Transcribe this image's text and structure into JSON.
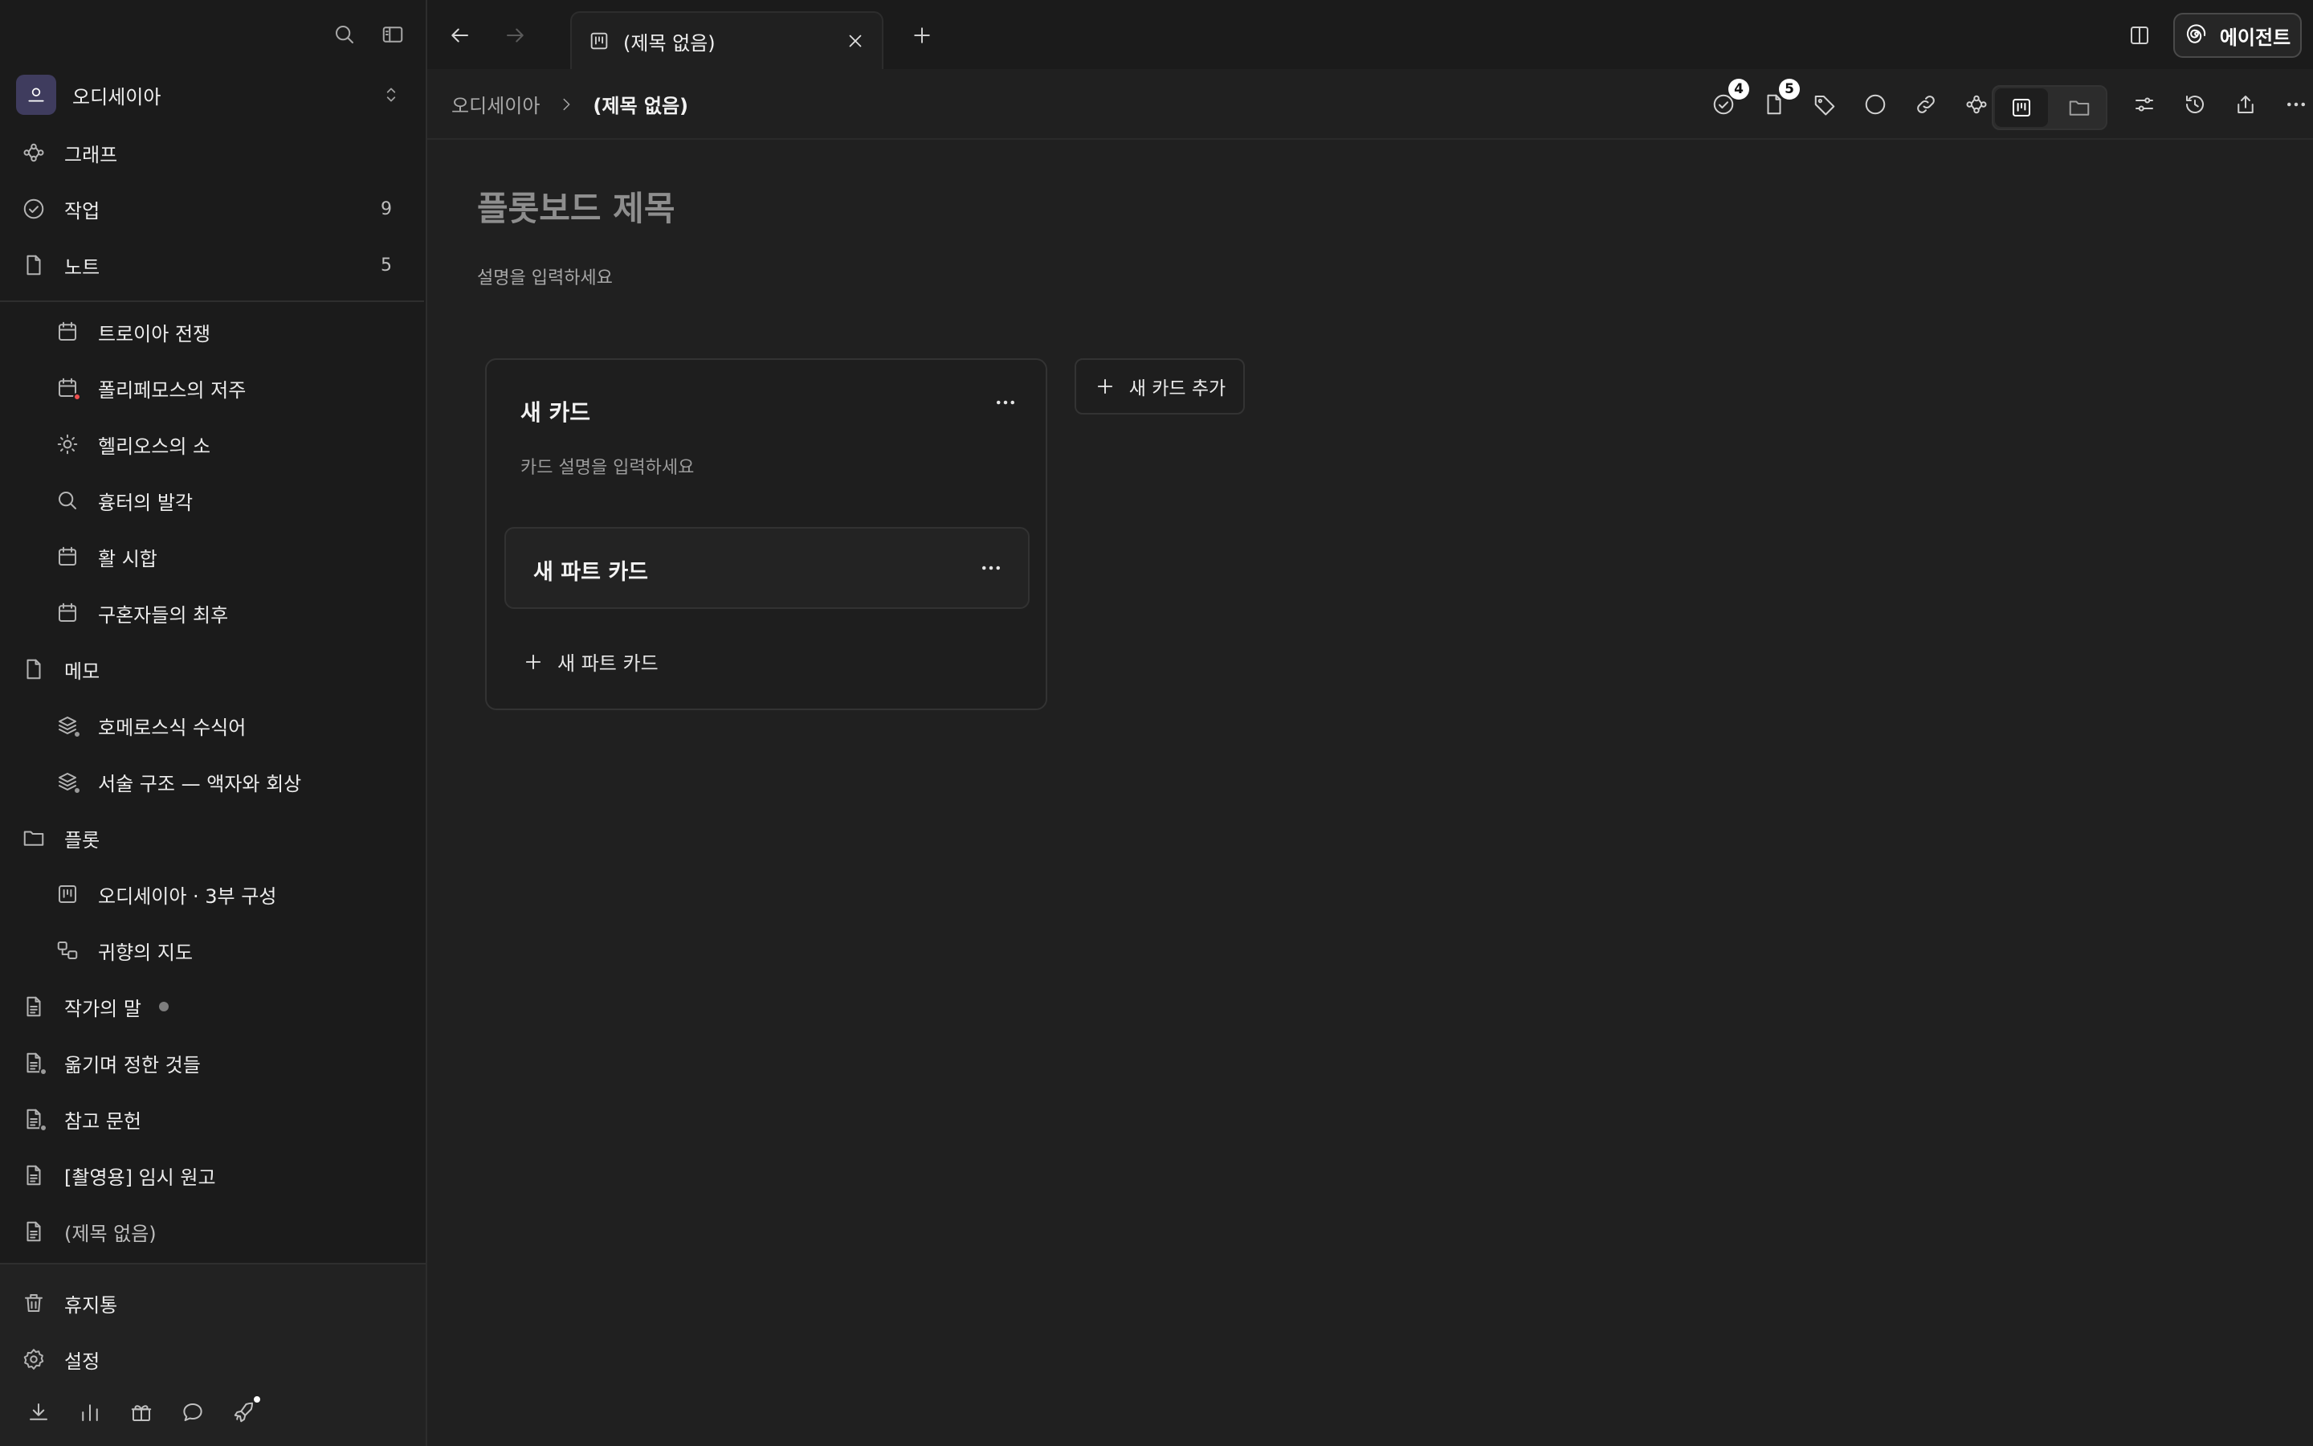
{
  "sidebar": {
    "workspace": {
      "initial": "오",
      "name": "오디세이아"
    },
    "nav": [
      {
        "label": "그래프"
      },
      {
        "label": "작업",
        "count": "9"
      },
      {
        "label": "노트",
        "count": "5"
      }
    ],
    "tree": [
      {
        "label": "트로이아 전쟁"
      },
      {
        "label": "폴리페모스의 저주"
      },
      {
        "label": "헬리오스의 소"
      },
      {
        "label": "흉터의 발각"
      },
      {
        "label": "활 시합"
      },
      {
        "label": "구혼자들의 최후"
      },
      {
        "label": "메모"
      },
      {
        "label": "호메로스식 수식어"
      },
      {
        "label": "서술 구조 — 액자와 회상"
      },
      {
        "label": "플롯"
      },
      {
        "label": "오디세이아 · 3부 구성"
      },
      {
        "label": "귀향의 지도"
      },
      {
        "label": "작가의 말"
      },
      {
        "label": "옮기며 정한 것들"
      },
      {
        "label": "참고 문헌"
      },
      {
        "label": "[촬영용] 임시 원고"
      },
      {
        "label": "(제목 없음)"
      }
    ],
    "bottom": {
      "trash": "휴지통",
      "settings": "설정"
    }
  },
  "tabs": [
    {
      "label": "(제목 없음)"
    }
  ],
  "agent_label": "에이전트",
  "breadcrumb": {
    "root": "오디세이아",
    "current": "(제목 없음)"
  },
  "toolbar_badges": {
    "tasks": "4",
    "notes": "5"
  },
  "board": {
    "title_placeholder": "플롯보드 제목",
    "desc_placeholder": "설명을 입력하세요",
    "card": {
      "title": "새 카드",
      "desc_placeholder": "카드 설명을 입력하세요",
      "part": {
        "title": "새 파트 카드"
      },
      "add_part_label": "새 파트 카드"
    },
    "add_card_label": "새 카드 추가"
  }
}
